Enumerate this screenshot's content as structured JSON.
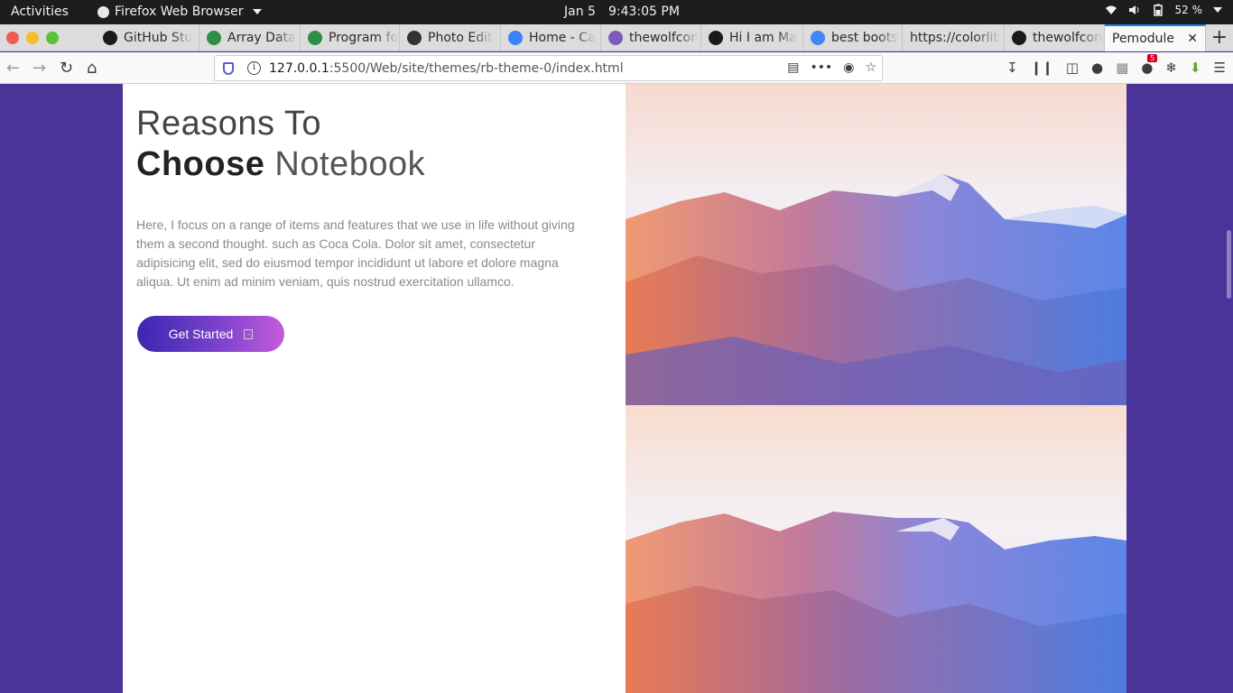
{
  "system_bar": {
    "activities": "Activities",
    "app_name": "Firefox Web Browser",
    "date": "Jan 5",
    "time": "9:43:05 PM",
    "battery": "52 %"
  },
  "tabs": [
    {
      "label": "GitHub Stu",
      "icon": "github-icon",
      "color": "#1a1a1a"
    },
    {
      "label": "Array Data",
      "icon": "gfg-icon",
      "color": "#2f8d46"
    },
    {
      "label": "Program fo",
      "icon": "gfg-icon",
      "color": "#2f8d46"
    },
    {
      "label": "Photo Edit",
      "icon": "aperture-icon",
      "color": "#333333"
    },
    {
      "label": "Home - Ca",
      "icon": "canva-icon",
      "color": "#3b82f6"
    },
    {
      "label": "thewolfcon",
      "icon": "h-icon",
      "color": "#7b5cb8"
    },
    {
      "label": "Hi I am Ma",
      "icon": "github-icon",
      "color": "#1a1a1a"
    },
    {
      "label": "best boots",
      "icon": "google-icon",
      "color": "#4285f4"
    },
    {
      "label": "https://colorlib",
      "icon": "none",
      "color": ""
    },
    {
      "label": "thewolfcon",
      "icon": "github-icon",
      "color": "#1a1a1a"
    },
    {
      "label": "Pemodule",
      "icon": "none",
      "color": "",
      "active": true
    }
  ],
  "url": {
    "host": "127.0.0.1",
    "rest": ":5500/Web/site/themes/rb-theme-0/index.html"
  },
  "toolbar": {
    "addon_badge": "5"
  },
  "page": {
    "heading_line1": "Reasons To",
    "heading_bold": "Choose",
    "heading_rest": "Notebook",
    "paragraph": "Here, I focus on a range of items and features that we use in life without giving them a second thought. such as Coca Cola. Dolor sit amet, consectetur adipisicing elit, sed do eiusmod tempor incididunt ut labore et dolore magna aliqua. Ut enim ad minim veniam, quis nostrud exercitation ullamco.",
    "cta_label": "Get Started"
  },
  "colors": {
    "page_background": "#4a3498",
    "button_gradient_start": "#3a26b0",
    "button_gradient_end": "#c45bd8",
    "active_tab_accent": "#0a84ff"
  }
}
